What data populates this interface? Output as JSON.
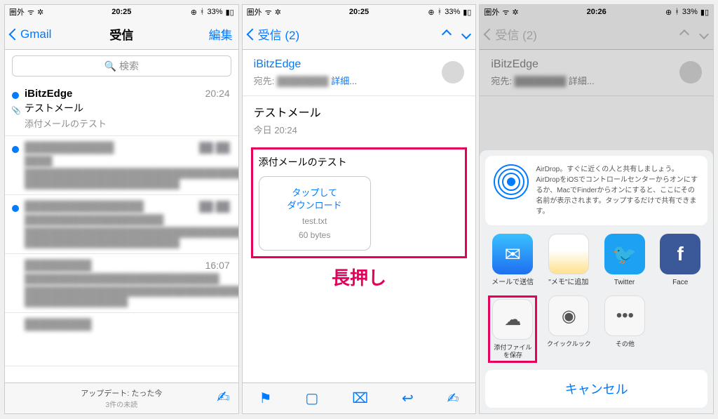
{
  "status": {
    "carrier": "圏外",
    "time1": "20:25",
    "time2": "20:25",
    "time3": "20:26",
    "battery": "33%"
  },
  "s1": {
    "back": "Gmail",
    "title": "受信",
    "edit": "編集",
    "search": "検索",
    "row1": {
      "sender": "iBitzEdge",
      "time": "20:24",
      "subject": "テストメール",
      "preview": "添付メールのテスト"
    },
    "row4time": "16:07",
    "update": "アップデート: たった今",
    "unread": "3件の未読"
  },
  "s2": {
    "back": "受信 (2)",
    "from": "iBitzEdge",
    "to_label": "宛先:",
    "detail": "詳細...",
    "subject": "テストメール",
    "date": "今日 20:24",
    "body": "添付メールのテスト",
    "tap1": "タップして",
    "tap2": "ダウンロード",
    "filename": "test.txt",
    "size": "60 bytes",
    "anno": "長押し"
  },
  "s3": {
    "back": "受信 (2)",
    "from": "iBitzEdge",
    "to_label": "宛先:",
    "detail": "詳細...",
    "airdrop": "AirDrop。すぐに近くの人と共有しましょう。AirDropをiOSでコントロールセンターからオンにするか、MacでFinderからオンにすると、ここにその名前が表示されます。タップするだけで共有できます。",
    "share": {
      "mail": "メールで送信",
      "notes": "\"メモ\"に追加",
      "twitter": "Twitter",
      "fb": "Face"
    },
    "actions": {
      "save": "添付ファイルを保存",
      "ql": "クイックルック",
      "other": "その他"
    },
    "cancel": "キャンセル"
  }
}
